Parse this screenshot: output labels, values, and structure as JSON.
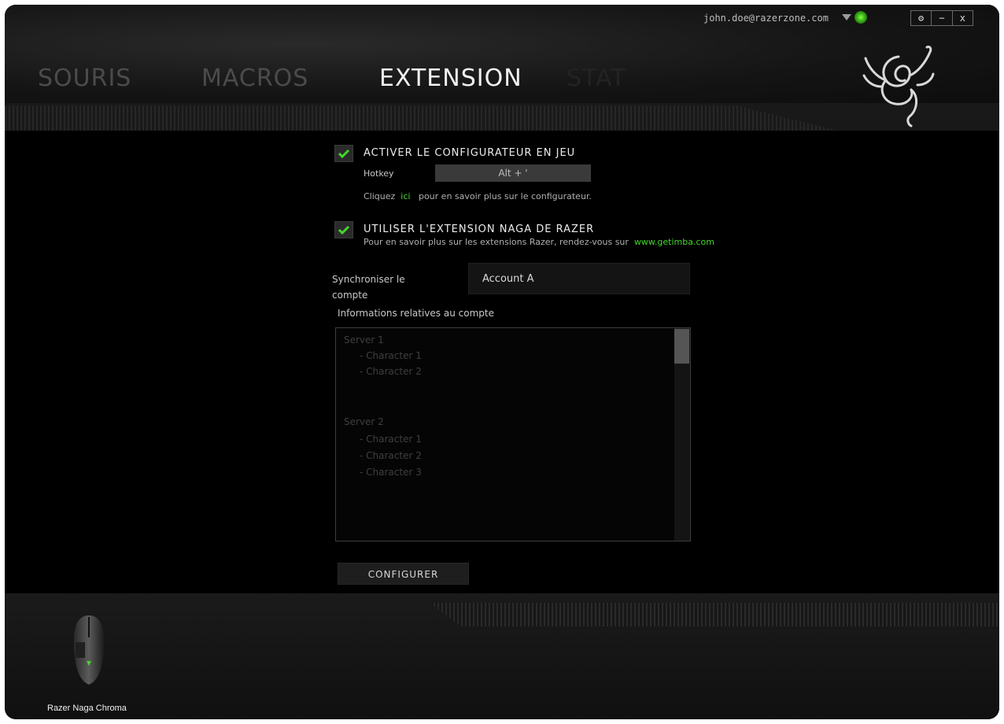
{
  "account": {
    "email": "john.doe@razerzone.com"
  },
  "window_controls": {
    "settings": "⚙",
    "minimize": "−",
    "close": "x"
  },
  "tabs": [
    {
      "label": "SOURIS",
      "active": false
    },
    {
      "label": "MACROS",
      "active": false
    },
    {
      "label": "EXTENSION",
      "active": true
    },
    {
      "label": "STAT",
      "active": false
    }
  ],
  "option1": {
    "label": "ACTIVER LE CONFIGURATEUR EN JEU",
    "hotkey_label": "Hotkey",
    "hotkey_value": "Alt + '",
    "info_prefix": "Cliquez",
    "info_link": "ici",
    "info_suffix": "pour en savoir plus sur le configurateur."
  },
  "option2": {
    "label": "UTILISER L'EXTENSION NAGA DE RAZER",
    "info_text": "Pour en savoir plus sur les extensions Razer, rendez-vous sur",
    "info_link": "www.getimba.com"
  },
  "sync": {
    "label_line1": "Synchroniser le",
    "label_line2": "compte",
    "value": "Account A"
  },
  "account_info": {
    "title": "Informations relatives au compte",
    "items": [
      "Server 1",
      "- Character 1",
      "- Character 2",
      "Server 2",
      "- Character 1",
      "- Character 2",
      "- Character 3"
    ]
  },
  "configure_button": "CONFIGURER",
  "device": {
    "name": "Razer Naga Chroma"
  },
  "colors": {
    "accent": "#44d62c",
    "background": "#000000"
  }
}
